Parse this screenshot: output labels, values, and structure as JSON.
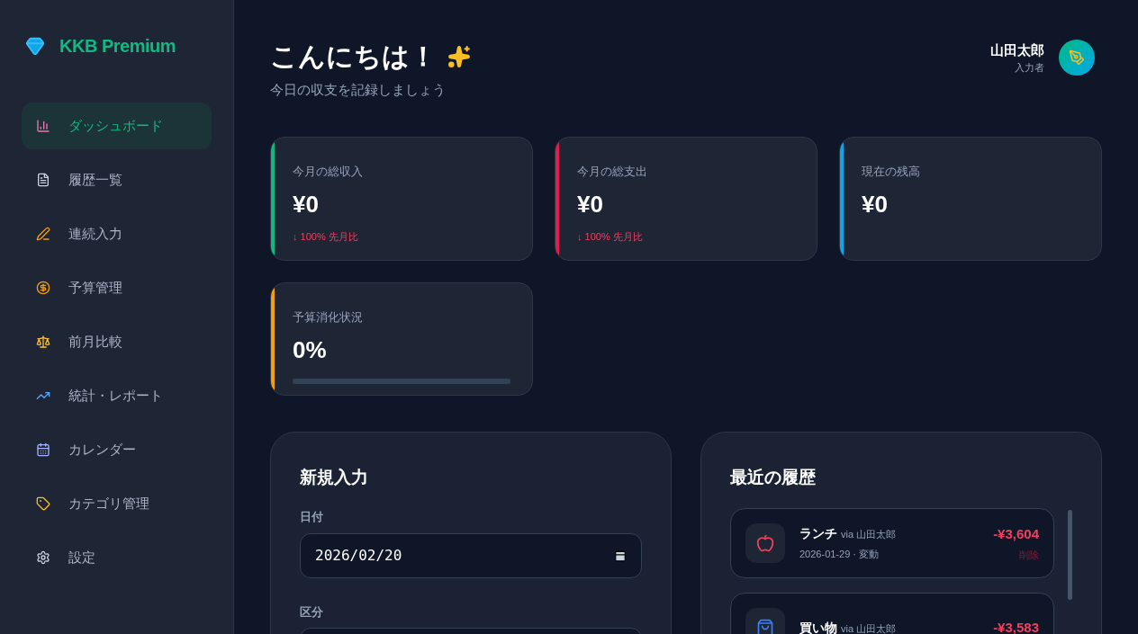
{
  "brand": {
    "name": "KKB Premium"
  },
  "sidebar": {
    "items": [
      {
        "label": "ダッシュボード",
        "selected": true
      },
      {
        "label": "履歴一覧",
        "selected": false
      },
      {
        "label": "連続入力",
        "selected": false
      },
      {
        "label": "予算管理",
        "selected": false
      },
      {
        "label": "前月比較",
        "selected": false
      },
      {
        "label": "統計・レポート",
        "selected": false
      },
      {
        "label": "カレンダー",
        "selected": false
      },
      {
        "label": "カテゴリ管理",
        "selected": false
      },
      {
        "label": "設定",
        "selected": false
      }
    ]
  },
  "header": {
    "title": "こんにちは！",
    "subtitle": "今日の収支を記録しましょう",
    "user": {
      "name": "山田太郎",
      "role": "入力者"
    }
  },
  "stats": [
    {
      "kind": "amount",
      "label": "今月の総収入",
      "value": "¥0",
      "trend": "↓ 100% 先月比",
      "color": "#10b981"
    },
    {
      "kind": "amount",
      "label": "今月の総支出",
      "value": "¥0",
      "trend": "↓ 100% 先月比",
      "color": "#e11d48"
    },
    {
      "kind": "amount",
      "label": "現在の残高",
      "value": "¥0",
      "color": "#0ea5e9"
    },
    {
      "kind": "progress",
      "label": "予算消化状況",
      "value": "0%",
      "level": 0,
      "color": "#f59e0b"
    }
  ],
  "new_entry": {
    "title": "新規入力",
    "fields": [
      {
        "label": "日付",
        "value": "2026/02/20"
      },
      {
        "label": "区分"
      }
    ]
  },
  "recent": {
    "title": "最近の履歴",
    "items": [
      {
        "name": "ランチ",
        "via": "via 山田太郎",
        "meta": "2026-01-29 · 変動",
        "amount": "-¥3,604",
        "action": "削除"
      },
      {
        "name": "買い物",
        "via": "via 山田太郎",
        "amount": "-¥3,583"
      }
    ]
  }
}
